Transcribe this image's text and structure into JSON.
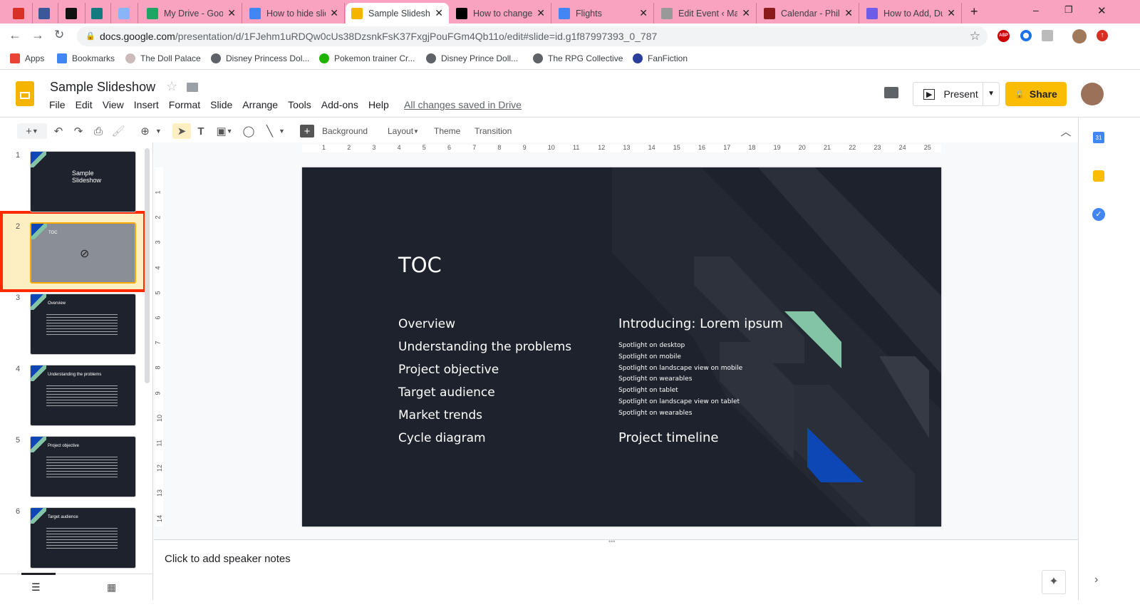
{
  "browser": {
    "tabs": [
      {
        "title": "",
        "icon": "gmail-icon",
        "color": "#d93025"
      },
      {
        "title": "",
        "icon": "facebook-icon",
        "color": "#3b5998"
      },
      {
        "title": "",
        "icon": "instapaper-icon",
        "color": "#111"
      },
      {
        "title": "",
        "icon": "map-icon",
        "color": "#137a7f"
      },
      {
        "title": "",
        "icon": "lock-tab-icon",
        "color": "#8ab4f8"
      },
      {
        "title": "My Drive - Google Drive",
        "icon": "drive-icon",
        "color": "#1fa463"
      },
      {
        "title": "How to hide slides",
        "icon": "docs-icon",
        "color": "#4285f4"
      },
      {
        "title": "Sample Slideshow",
        "icon": "slides-icon",
        "color": "#f4b400"
      },
      {
        "title": "How to change",
        "icon": "bi-icon",
        "color": "#000"
      },
      {
        "title": "Flights",
        "icon": "flights-icon",
        "color": "#4285f4"
      },
      {
        "title": "Edit Event ‹ Ma",
        "icon": "event-icon",
        "color": "#999"
      },
      {
        "title": "Calendar - Phila",
        "icon": "mt-icon",
        "color": "#8b1a1a"
      },
      {
        "title": "How to Add, Du",
        "icon": "app-icon",
        "color": "#6c5ce7"
      }
    ],
    "url_host": "docs.google.com",
    "url_path": "/presentation/d/1FJehm1uRDQw0cUs38DzsnkFsK37FxgjPouFGm4Qb11o/edit#slide=id.g1f87997393_0_787",
    "bookmarks": [
      "Apps",
      "Bookmarks",
      "The Doll Palace",
      "Disney Princess Dol...",
      "Pokemon trainer Cr...",
      "Disney Prince Doll...",
      "The RPG Collective",
      "FanFiction"
    ]
  },
  "doc": {
    "title": "Sample Slideshow",
    "menu": [
      "File",
      "Edit",
      "View",
      "Insert",
      "Format",
      "Slide",
      "Arrange",
      "Tools",
      "Add-ons",
      "Help"
    ],
    "saved": "All changes saved in Drive",
    "present": "Present",
    "share": "Share"
  },
  "toolbar": {
    "background": "Background",
    "layout": "Layout",
    "theme": "Theme",
    "transition": "Transition"
  },
  "ruler": [
    "1",
    "2",
    "3",
    "4",
    "5",
    "6",
    "7",
    "8",
    "9",
    "10",
    "11",
    "12",
    "13",
    "14",
    "15",
    "16",
    "17",
    "18",
    "19",
    "20",
    "21",
    "22",
    "23",
    "24",
    "25"
  ],
  "vruler": [
    "1",
    "2",
    "3",
    "4",
    "5",
    "6",
    "7",
    "8",
    "9",
    "10",
    "11",
    "12",
    "13",
    "14"
  ],
  "filmstrip": [
    {
      "num": "1",
      "title": "Sample Slideshow"
    },
    {
      "num": "2",
      "title": "TOC"
    },
    {
      "num": "3",
      "title": "Overview"
    },
    {
      "num": "4",
      "title": "Understanding the problems"
    },
    {
      "num": "5",
      "title": "Project objective"
    },
    {
      "num": "6",
      "title": "Target audience"
    }
  ],
  "slide": {
    "title": "TOC",
    "left": [
      "Overview",
      "Understanding the problems",
      "Project objective",
      "Target audience",
      "Market trends",
      "Cycle diagram"
    ],
    "right_heading": "Introducing: Lorem ipsum",
    "right_items": [
      "Spotlight on desktop",
      "Spotlight on mobile",
      "Spotlight on landscape view on mobile",
      "Spotlight on wearables",
      "Spotlight on tablet",
      "Spotlight on landscape view on tablet",
      "Spotlight on wearables"
    ],
    "right_footer": "Project timeline"
  },
  "notes": {
    "placeholder": "Click to add speaker notes"
  },
  "colors": {
    "tabbar": "#f9a3c0",
    "slide_bg": "#1e222c",
    "accent_green": "#82c4a5",
    "accent_blue": "#0d47b5",
    "share": "#fbbc04",
    "highlight": "#ff2a00"
  }
}
